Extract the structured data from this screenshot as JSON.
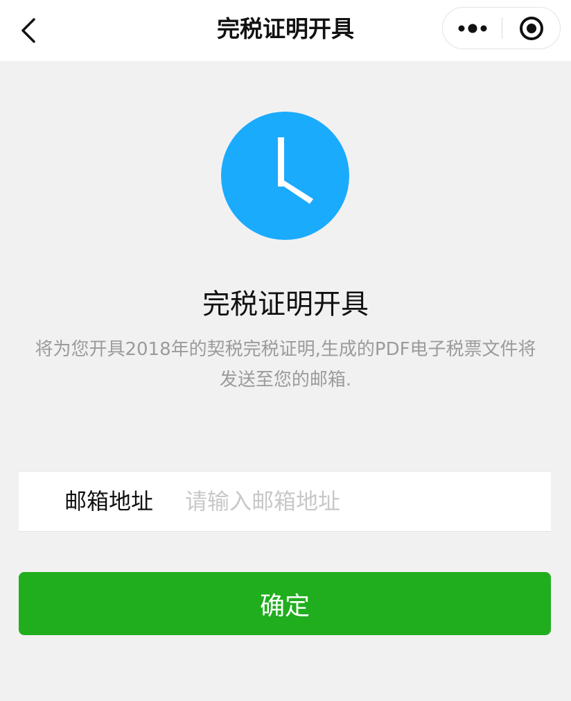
{
  "nav": {
    "title": "完税证明开具",
    "back_icon": "chevron-left-icon",
    "more_icon": "more-dots-icon",
    "close_icon": "target-close-icon"
  },
  "hero": {
    "icon": "clock-icon",
    "icon_color": "#1aabfd",
    "heading": "完税证明开具",
    "description": "将为您开具2018年的契税完税证明,生成的PDF电子税票文件将发送至您的邮箱."
  },
  "form": {
    "email_label": "邮箱地址",
    "email_placeholder": "请输入邮箱地址",
    "email_value": ""
  },
  "actions": {
    "confirm_label": "确定",
    "confirm_color": "#20ae1e"
  }
}
